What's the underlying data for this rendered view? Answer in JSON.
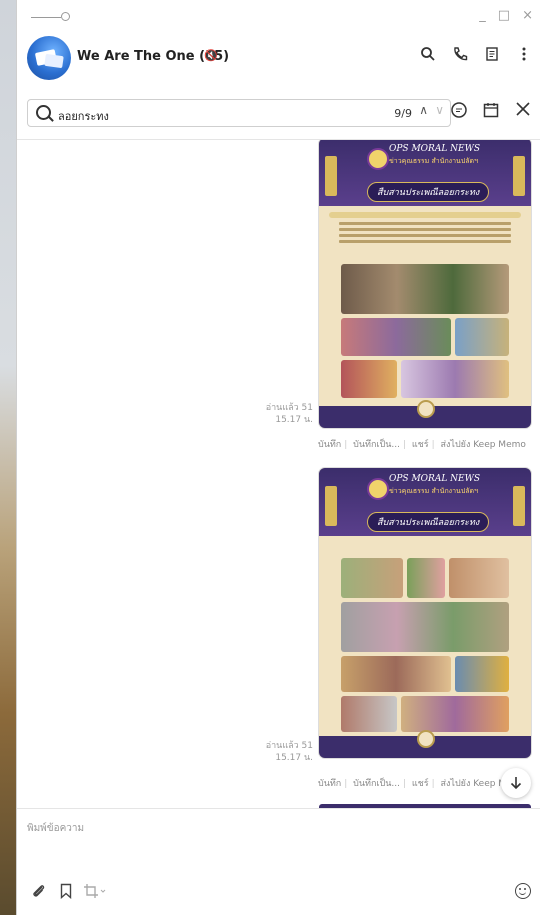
{
  "window": {
    "controls": [
      "_",
      "□",
      "×"
    ]
  },
  "header": {
    "title": "We Are The One (55)",
    "mute_icon": "mute-icon",
    "icons": [
      "search-icon",
      "phone-icon",
      "notes-icon",
      "more-icon"
    ]
  },
  "search": {
    "query": "ลอยกระทง",
    "count": "9/9",
    "up": "∧",
    "down": "∨",
    "row_icons": [
      "chat-bubble-icon",
      "calendar-icon",
      "close-icon"
    ]
  },
  "messages": [
    {
      "poster": {
        "title": "OPS MORAL NEWS",
        "subtitle": "ข่าวคุณธรรม สำนักงานปลัดฯ",
        "banner": "สืบสานประเพณีลอยกระทง"
      },
      "read": "อ่านแล้ว 51",
      "time": "15.17 น.",
      "actions": [
        "บันทึก",
        "บันทึกเป็น...",
        "แชร์",
        "ส่งไปยัง Keep Memo"
      ]
    },
    {
      "poster": {
        "title": "OPS MORAL NEWS",
        "subtitle": "ข่าวคุณธรรม สำนักงานปลัดฯ",
        "banner": "สืบสานประเพณีลอยกระทง"
      },
      "read": "อ่านแล้ว 51",
      "time": "15.17 น.",
      "actions": [
        "บันทึก",
        "บันทึกเป็น...",
        "แชร์",
        "ส่งไปยัง Keep Memo"
      ]
    }
  ],
  "composer": {
    "placeholder": "พิมพ์ข้อความ",
    "tools": [
      "paperclip-icon",
      "bookmark-icon",
      "crop-icon",
      "emoji-icon"
    ]
  }
}
